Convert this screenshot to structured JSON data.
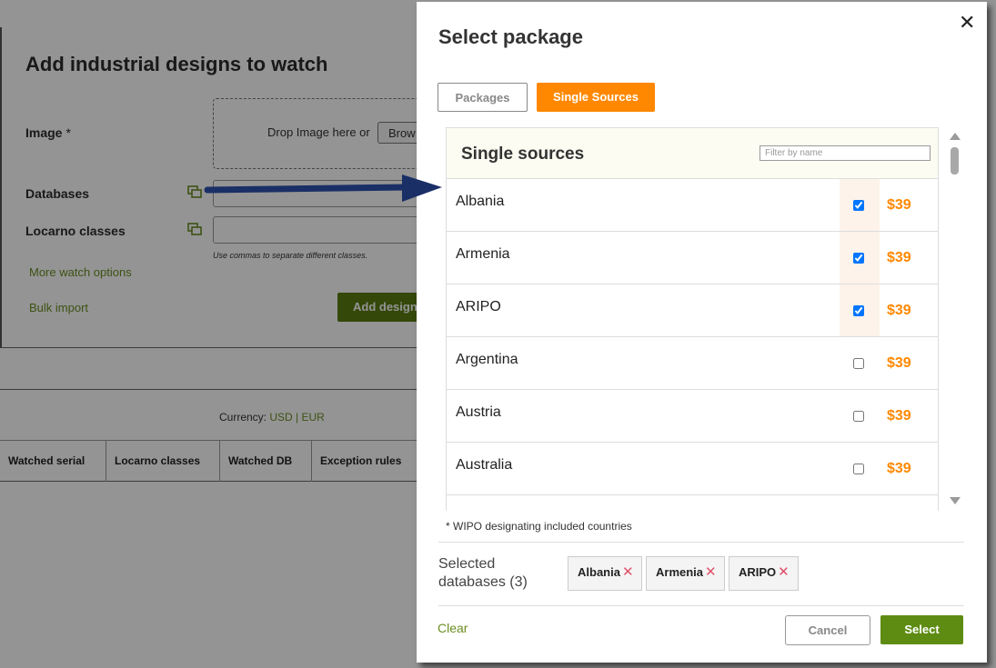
{
  "background": {
    "title": "Add industrial designs to watch",
    "image_label": "Image",
    "required_mark": "*",
    "drop_text": "Drop Image here or",
    "browse_label": "Brow",
    "databases_label": "Databases",
    "locarno_label": "Locarno classes",
    "locarno_hint": "Use commas to separate different classes.",
    "more_watch_options": "More watch options",
    "bulk_import": "Bulk import",
    "add_button": "Add design",
    "currency_label": "Currency:",
    "currency_usd": "USD",
    "currency_sep": "|",
    "currency_eur": "EUR",
    "table_headers": [
      "Watched serial",
      "Locarno classes",
      "Watched DB",
      "Exception rules"
    ]
  },
  "modal": {
    "title": "Select package",
    "close_glyph": "✕",
    "tabs": {
      "packages": "Packages",
      "single_sources": "Single Sources"
    },
    "list_title": "Single sources",
    "filter_placeholder": "Filter by name",
    "sources": [
      {
        "name": "Albania",
        "price": "$39",
        "checked": true
      },
      {
        "name": "Armenia",
        "price": "$39",
        "checked": true
      },
      {
        "name": "ARIPO",
        "price": "$39",
        "checked": true
      },
      {
        "name": "Argentina",
        "price": "$39",
        "checked": false
      },
      {
        "name": "Austria",
        "price": "$39",
        "checked": false
      },
      {
        "name": "Australia",
        "price": "$39",
        "checked": false
      }
    ],
    "wipo_note": "* WIPO designating included countries",
    "selected_label": "Selected databases (3)",
    "selected_chips": [
      "Albania",
      "Armenia",
      "ARIPO"
    ],
    "chip_remove_glyph": "✕",
    "clear_label": "Clear",
    "cancel_label": "Cancel",
    "select_label": "Select"
  },
  "colors": {
    "accent_orange": "#ff8800",
    "action_green": "#5e8c12",
    "link_green": "#6b8e23",
    "arrow_navy": "#1a2f66"
  }
}
